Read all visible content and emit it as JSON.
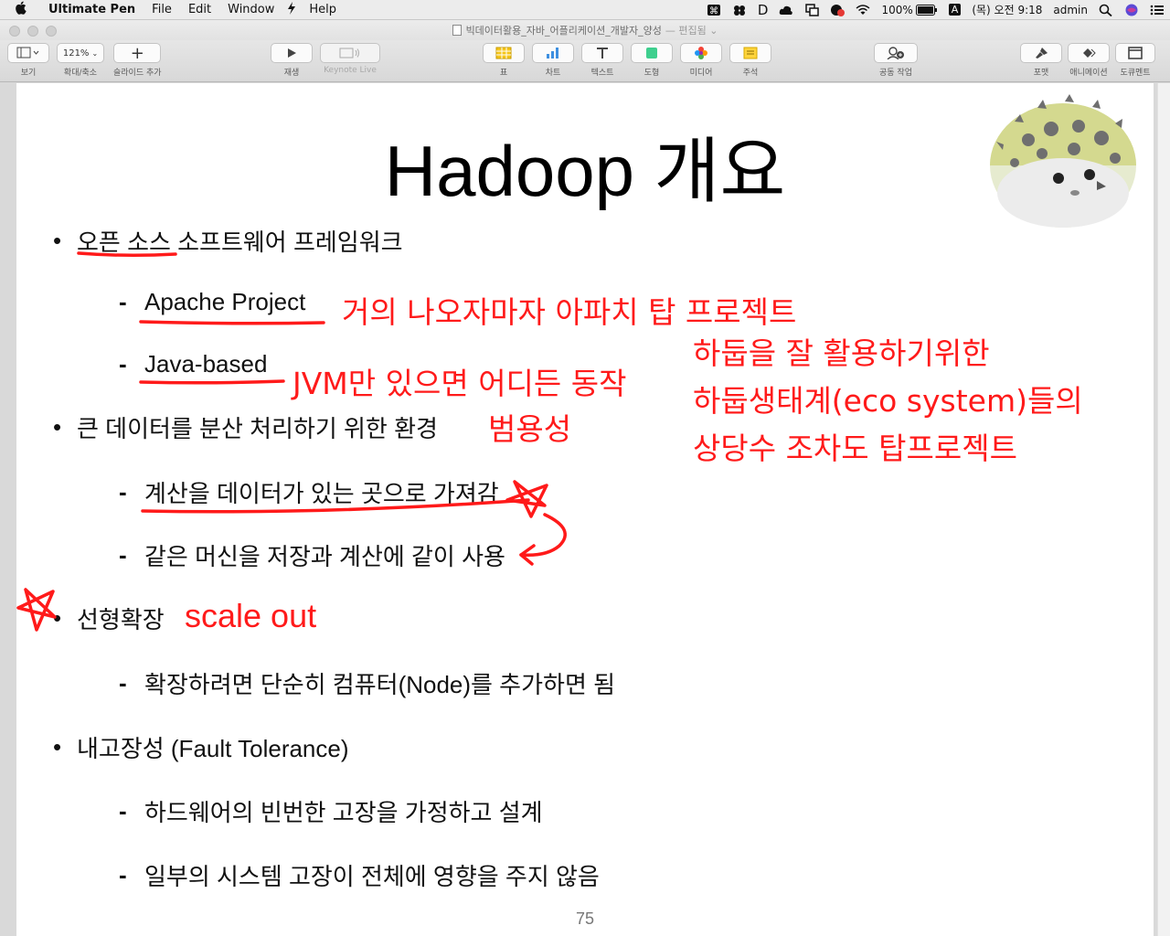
{
  "menubar": {
    "apple": "",
    "app_name": "Ultimate Pen",
    "menus": [
      "File",
      "Edit",
      "Window",
      "Help"
    ],
    "status": {
      "battery": "100%",
      "input_source": "A",
      "datetime": "(목) 오전 9:18",
      "user": "admin"
    }
  },
  "window": {
    "title": "빅데이터활용_자바_어플리케이션_개발자_양성",
    "edited_label": "— 편집됨 ⌄"
  },
  "toolbar": {
    "view_label": "보기",
    "zoom_value": "121%",
    "zoom_label": "확대/축소",
    "add_slide_label": "슬라이드 추가",
    "play_label": "재생",
    "keynote_live_label": "Keynote Live",
    "table_label": "표",
    "chart_label": "차트",
    "text_label": "텍스트",
    "shape_label": "도형",
    "media_label": "미디어",
    "comment_label": "주석",
    "collaborate_label": "공동 작업",
    "format_label": "포맷",
    "animate_label": "애니메이션",
    "document_label": "도큐멘트"
  },
  "slide": {
    "title": "Hadoop 개요",
    "page_number": "75",
    "bullets": [
      {
        "text": "오픈 소스 소프트웨어 프레임워크",
        "subs": [
          "Apache Project",
          "Java-based"
        ]
      },
      {
        "text": "큰 데이터를 분산 처리하기 위한 환경",
        "subs": [
          "계산을 데이터가 있는 곳으로 가져감",
          "같은 머신을 저장과 계산에 같이 사용"
        ]
      },
      {
        "text": "선형확장",
        "subs": [
          "확장하려면 단순히 컴퓨터(Node)를 추가하면 됨"
        ]
      },
      {
        "text": "내고장성 (Fault Tolerance)",
        "subs": [
          "하드웨어의 빈번한 고장을 가정하고 설계",
          "일부의 시스템 고장이 전체에 영향을 주지 않음"
        ]
      }
    ]
  },
  "annotations": {
    "color": "#ff1a1a",
    "apache_note": "거의 나오자마자 아파치 탑 프로젝트",
    "ecosystem_note_lines": [
      "하둡을 잘 활용하기위한",
      "하둡생태계(eco system)들의",
      "상당수 조차도 탑프로젝트"
    ],
    "jvm_note": "JVM만 있으면 어디든 동작",
    "generality_note": "범용성",
    "scale_note": "scale out"
  }
}
